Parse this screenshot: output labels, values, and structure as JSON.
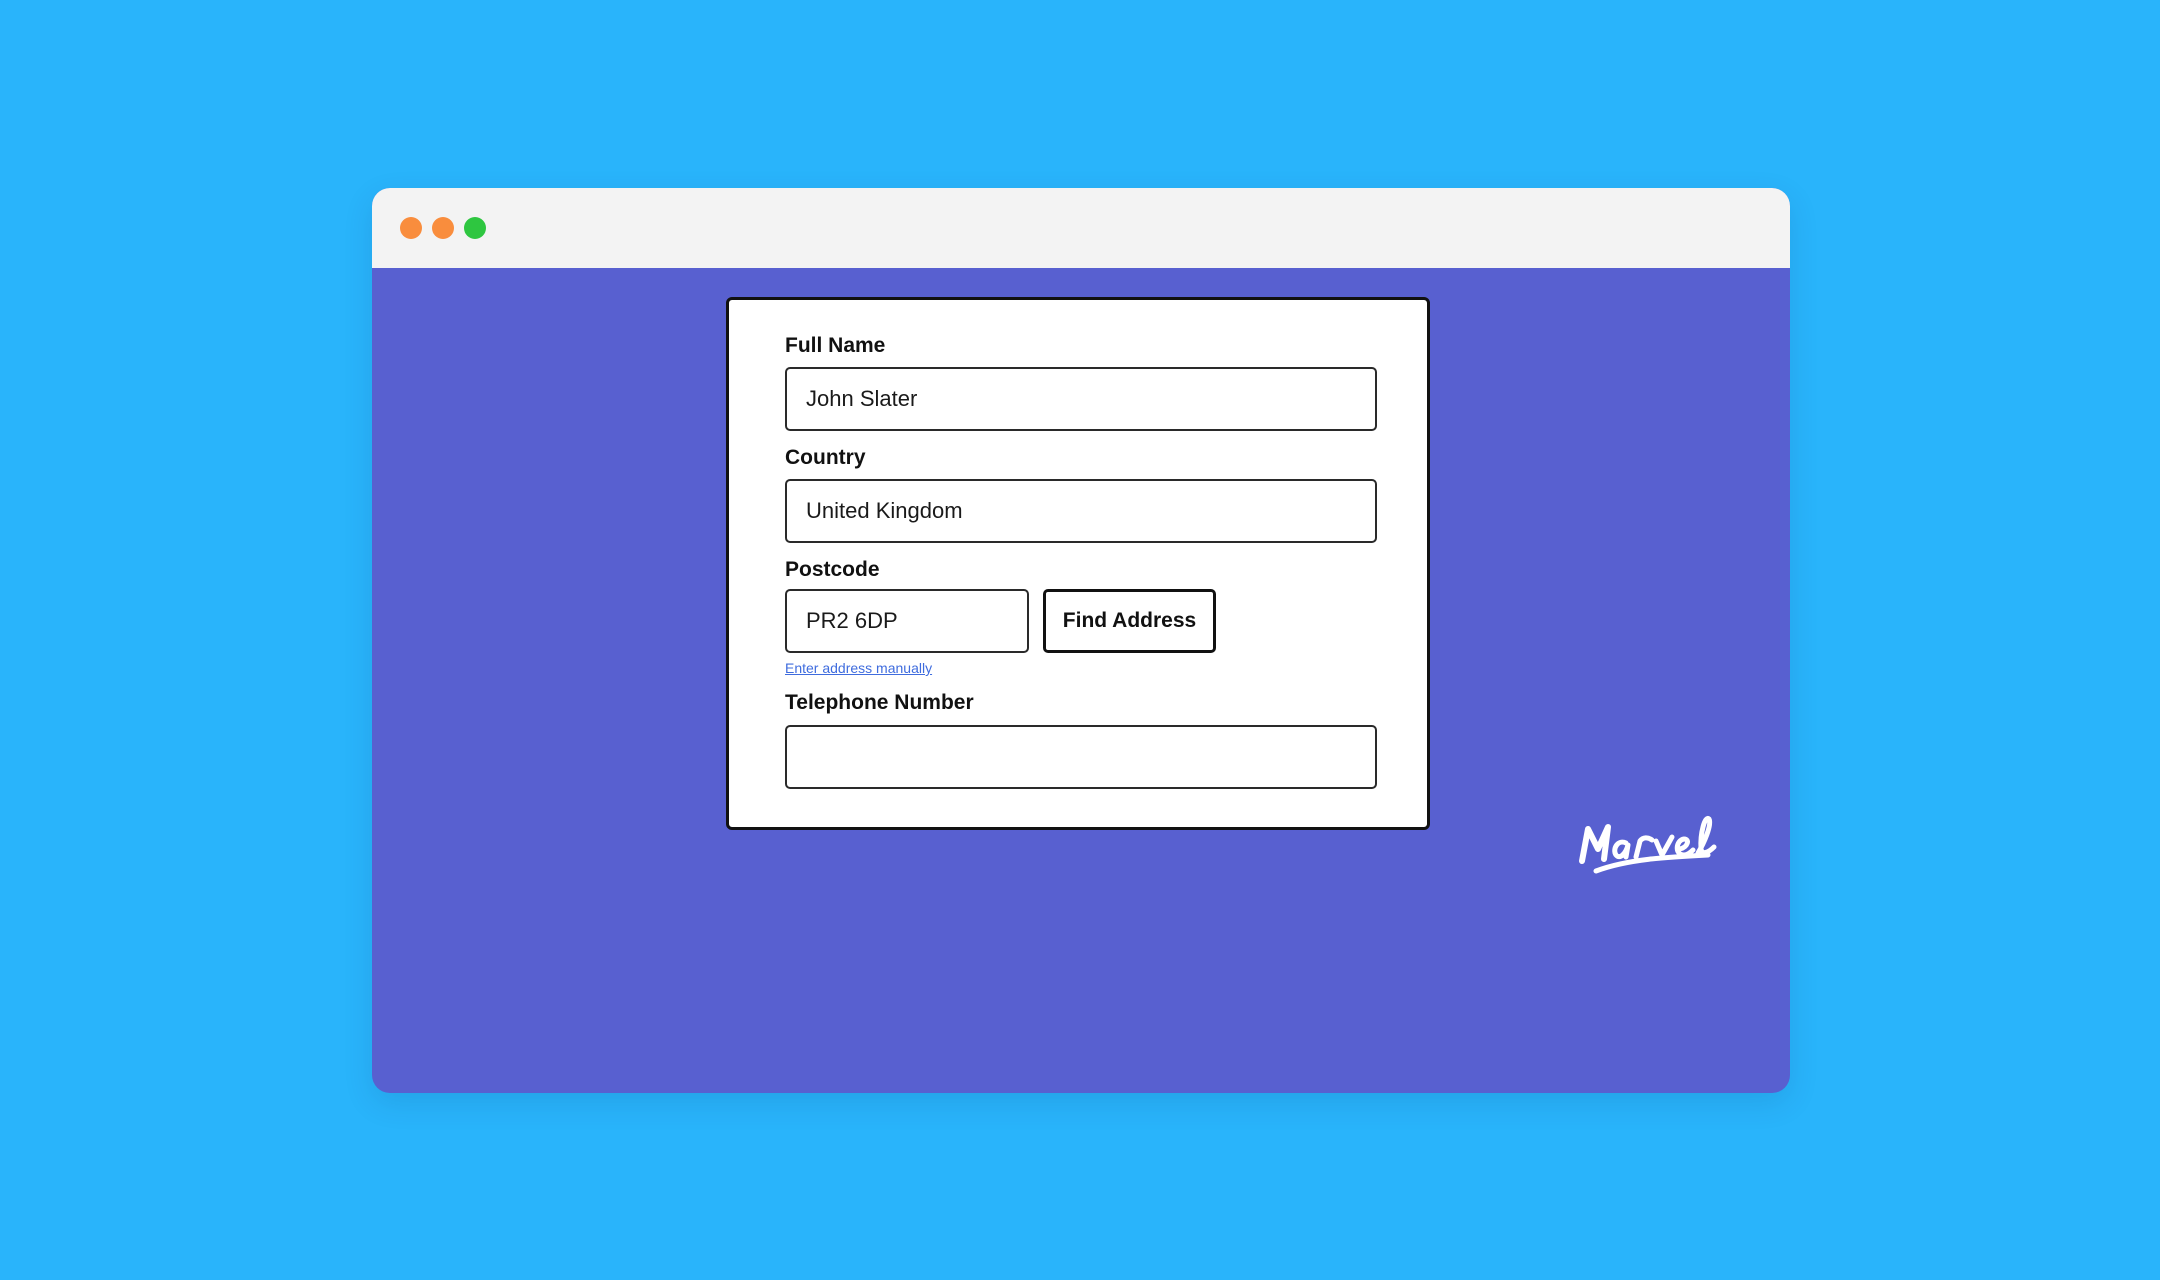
{
  "window": {
    "controls": [
      {
        "name": "close-dot",
        "color": "#f98d3d"
      },
      {
        "name": "minimize-dot",
        "color": "#f98d3d"
      },
      {
        "name": "maximize-dot",
        "color": "#2ec640"
      }
    ]
  },
  "colors": {
    "page_background": "#29b4fb",
    "app_background": "#5860d0",
    "titlebar": "#f3f3f3",
    "link": "#3f6cde"
  },
  "form": {
    "full_name": {
      "label": "Full Name",
      "value": "John Slater",
      "placeholder": ""
    },
    "country": {
      "label": "Country",
      "value": "United Kingdom",
      "placeholder": ""
    },
    "postcode": {
      "label": "Postcode",
      "value": "PR2 6DP",
      "placeholder": ""
    },
    "find_address_button": "Find Address",
    "manual_link": "Enter address manually",
    "telephone": {
      "label": "Telephone Number",
      "value": "",
      "placeholder": ""
    }
  },
  "branding": {
    "logo_text": "Marvel"
  }
}
